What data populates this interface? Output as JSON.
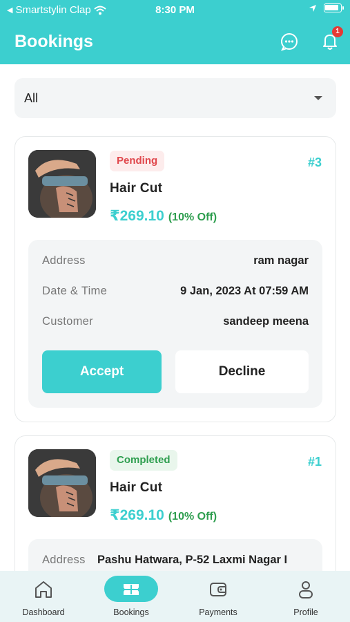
{
  "status_bar": {
    "carrier": "Smartstylin Clap",
    "time": "8:30 PM"
  },
  "header": {
    "title": "Bookings",
    "notification_count": "1"
  },
  "filter": {
    "selected": "All"
  },
  "bookings": [
    {
      "status": "Pending",
      "order_number": "#3",
      "service": "Hair Cut",
      "price": "₹269.10",
      "discount": "(10% Off)",
      "address_label": "Address",
      "address": "ram nagar",
      "datetime_label": "Date & Time",
      "datetime": "9 Jan, 2023 At 07:59 AM",
      "customer_label": "Customer",
      "customer": "sandeep meena",
      "accept_label": "Accept",
      "decline_label": "Decline"
    },
    {
      "status": "Completed",
      "order_number": "#1",
      "service": "Hair Cut",
      "price": "₹269.10",
      "discount": "(10% Off)",
      "address_label": "Address",
      "address": "Pashu Hatwara, P-52 Laxmi Nagar I"
    }
  ],
  "tabs": [
    {
      "label": "Dashboard",
      "icon": "home-icon"
    },
    {
      "label": "Bookings",
      "icon": "ticket-icon",
      "active": true
    },
    {
      "label": "Payments",
      "icon": "wallet-icon"
    },
    {
      "label": "Profile",
      "icon": "user-icon"
    }
  ],
  "colors": {
    "accent": "#3ccfcf",
    "pending": "#e0474c",
    "completed": "#2e9e4f",
    "badge": "#e53935"
  }
}
